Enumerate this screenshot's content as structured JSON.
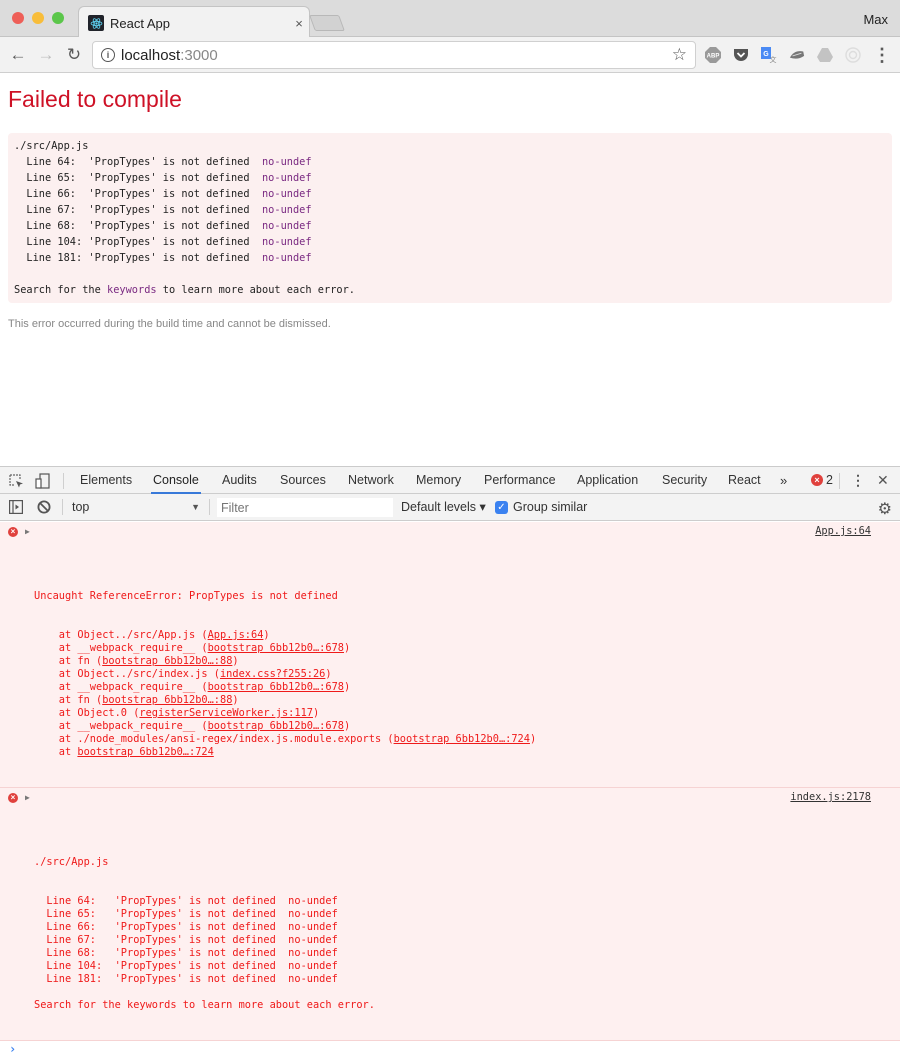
{
  "browser": {
    "tab_title": "React App",
    "tab_close": "×",
    "profile_name": "Max",
    "url_host": "localhost",
    "url_port": ":3000",
    "nav": {
      "back": "←",
      "forward": "→",
      "reload": "↻"
    },
    "extensions": [
      "abp-icon",
      "pocket-icon",
      "google-translate-icon",
      "extension-icon",
      "drive-icon",
      "extension-circle-icon"
    ],
    "menu": "⋮"
  },
  "page": {
    "title": "Failed to compile",
    "file": "./src/App.js",
    "errors": [
      {
        "line": "Line 64:",
        "message": "'PropTypes' is not defined",
        "rule": "no-undef"
      },
      {
        "line": "Line 65:",
        "message": "'PropTypes' is not defined",
        "rule": "no-undef"
      },
      {
        "line": "Line 66:",
        "message": "'PropTypes' is not defined",
        "rule": "no-undef"
      },
      {
        "line": "Line 67:",
        "message": "'PropTypes' is not defined",
        "rule": "no-undef"
      },
      {
        "line": "Line 68:",
        "message": "'PropTypes' is not defined",
        "rule": "no-undef"
      },
      {
        "line": "Line 104:",
        "message": "'PropTypes' is not defined",
        "rule": "no-undef"
      },
      {
        "line": "Line 181:",
        "message": "'PropTypes' is not defined",
        "rule": "no-undef"
      }
    ],
    "hint_prefix": "Search for the ",
    "hint_keyword": "keywords",
    "hint_suffix": " to learn more about each error.",
    "note": "This error occurred during the build time and cannot be dismissed."
  },
  "devtools": {
    "tabs": [
      "Elements",
      "Console",
      "Audits",
      "Sources",
      "Network",
      "Memory",
      "Performance",
      "Application",
      "Security",
      "React"
    ],
    "active_tab": "Console",
    "more": "»",
    "error_count": "2",
    "close": "✕",
    "context": "top",
    "filter_placeholder": "Filter",
    "levels": "Default levels ▾",
    "group_similar": "Group similar",
    "group_similar_checked": true,
    "messages": [
      {
        "head": "Uncaught ReferenceError: PropTypes is not defined",
        "source": "App.js:64",
        "stack": [
          {
            "pre": "    at Object../src/App.js (",
            "link": "App.js:64",
            "post": ")"
          },
          {
            "pre": "    at __webpack_require__ (",
            "link": "bootstrap 6bb12b0…:678",
            "post": ")"
          },
          {
            "pre": "    at fn (",
            "link": "bootstrap 6bb12b0…:88",
            "post": ")"
          },
          {
            "pre": "    at Object../src/index.js (",
            "link": "index.css?f255:26",
            "post": ")"
          },
          {
            "pre": "    at __webpack_require__ (",
            "link": "bootstrap 6bb12b0…:678",
            "post": ")"
          },
          {
            "pre": "    at fn (",
            "link": "bootstrap 6bb12b0…:88",
            "post": ")"
          },
          {
            "pre": "    at Object.0 (",
            "link": "registerServiceWorker.js:117",
            "post": ")"
          },
          {
            "pre": "    at __webpack_require__ (",
            "link": "bootstrap 6bb12b0…:678",
            "post": ")"
          },
          {
            "pre": "    at ./node_modules/ansi-regex/index.js.module.exports (",
            "link": "bootstrap 6bb12b0…:724",
            "post": ")"
          },
          {
            "pre": "    at ",
            "link": "bootstrap 6bb12b0…:724",
            "post": ""
          }
        ]
      },
      {
        "head": "./src/App.js",
        "source": "index.js:2178",
        "lines": [
          "  Line 64:   'PropTypes' is not defined  no-undef",
          "  Line 65:   'PropTypes' is not defined  no-undef",
          "  Line 66:   'PropTypes' is not defined  no-undef",
          "  Line 67:   'PropTypes' is not defined  no-undef",
          "  Line 68:   'PropTypes' is not defined  no-undef",
          "  Line 104:  'PropTypes' is not defined  no-undef",
          "  Line 181:  'PropTypes' is not defined  no-undef",
          "",
          "Search for the keywords to learn more about each error."
        ]
      }
    ],
    "prompt": "›"
  }
}
